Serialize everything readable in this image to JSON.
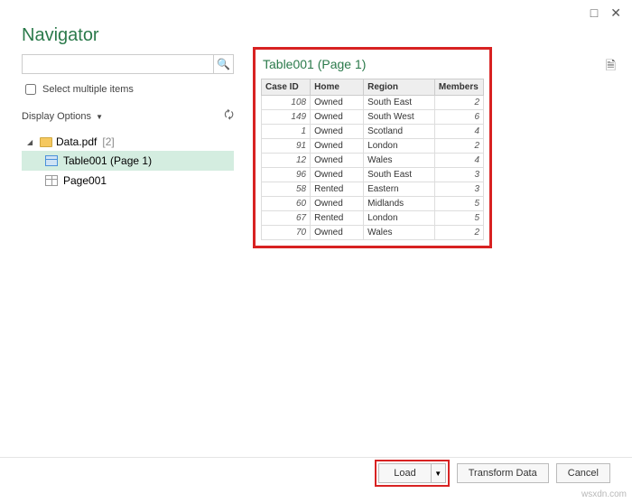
{
  "window": {
    "title": "Navigator"
  },
  "search": {
    "placeholder": ""
  },
  "multi_select_label": "Select multiple items",
  "display_options_label": "Display Options",
  "tree": {
    "root_name": "Data.pdf",
    "root_count": "[2]",
    "child_table": "Table001 (Page 1)",
    "child_page": "Page001"
  },
  "preview": {
    "title": "Table001 (Page 1)",
    "columns": [
      "Case ID",
      "Home",
      "Region",
      "Members"
    ],
    "rows": [
      {
        "case_id": "108",
        "home": "Owned",
        "region": "South East",
        "members": "2"
      },
      {
        "case_id": "149",
        "home": "Owned",
        "region": "South West",
        "members": "6"
      },
      {
        "case_id": "1",
        "home": "Owned",
        "region": "Scotland",
        "members": "4"
      },
      {
        "case_id": "91",
        "home": "Owned",
        "region": "London",
        "members": "2"
      },
      {
        "case_id": "12",
        "home": "Owned",
        "region": "Wales",
        "members": "4"
      },
      {
        "case_id": "96",
        "home": "Owned",
        "region": "South East",
        "members": "3"
      },
      {
        "case_id": "58",
        "home": "Rented",
        "region": "Eastern",
        "members": "3"
      },
      {
        "case_id": "60",
        "home": "Owned",
        "region": "Midlands",
        "members": "5"
      },
      {
        "case_id": "67",
        "home": "Rented",
        "region": "London",
        "members": "5"
      },
      {
        "case_id": "70",
        "home": "Owned",
        "region": "Wales",
        "members": "2"
      }
    ]
  },
  "footer": {
    "load": "Load",
    "transform": "Transform Data",
    "cancel": "Cancel"
  },
  "watermark": "wsxdn.com",
  "chart_data": {
    "type": "table",
    "title": "Table001 (Page 1)",
    "columns": [
      "Case ID",
      "Home",
      "Region",
      "Members"
    ],
    "rows": [
      [
        108,
        "Owned",
        "South East",
        2
      ],
      [
        149,
        "Owned",
        "South West",
        6
      ],
      [
        1,
        "Owned",
        "Scotland",
        4
      ],
      [
        91,
        "Owned",
        "London",
        2
      ],
      [
        12,
        "Owned",
        "Wales",
        4
      ],
      [
        96,
        "Owned",
        "South East",
        3
      ],
      [
        58,
        "Rented",
        "Eastern",
        3
      ],
      [
        60,
        "Owned",
        "Midlands",
        5
      ],
      [
        67,
        "Rented",
        "London",
        5
      ],
      [
        70,
        "Owned",
        "Wales",
        2
      ]
    ]
  }
}
